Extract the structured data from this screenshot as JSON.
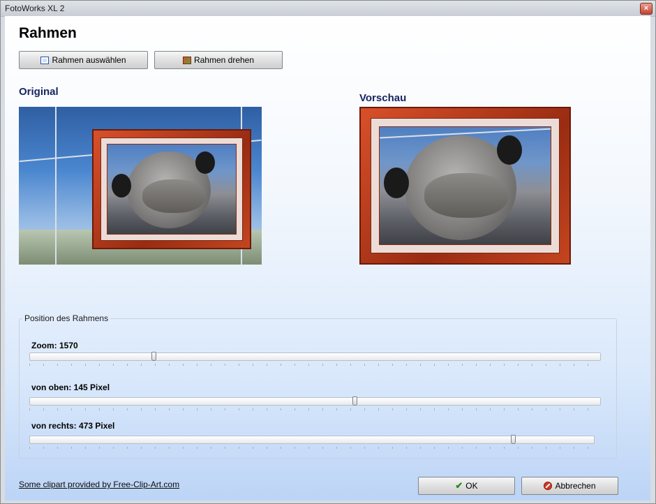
{
  "window": {
    "title": "FotoWorks XL 2",
    "close_glyph": "×"
  },
  "page": {
    "title": "Rahmen"
  },
  "toolbar": {
    "select_frame_label": "Rahmen auswählen",
    "select_frame_icon": "frame-select-icon",
    "rotate_frame_label": "Rahmen drehen",
    "rotate_frame_icon": "frame-rotate-icon"
  },
  "original": {
    "label": "Original"
  },
  "preview": {
    "label": "Vorschau"
  },
  "position_group": {
    "legend": "Position des Rahmens",
    "zoom": {
      "label": "Zoom: 1570",
      "value_fraction": 0.215
    },
    "top": {
      "label": "von oben: 145 Pixel",
      "value_fraction": 0.57
    },
    "right": {
      "label": "von rechts: 473 Pixel",
      "value_fraction": 0.86
    }
  },
  "footer": {
    "credit_link": "Some clipart provided by Free-Clip-Art.com",
    "ok_label": "OK",
    "cancel_label": "Abbrechen"
  },
  "colors": {
    "heading": "#16245e",
    "frame": "#b8401c"
  }
}
